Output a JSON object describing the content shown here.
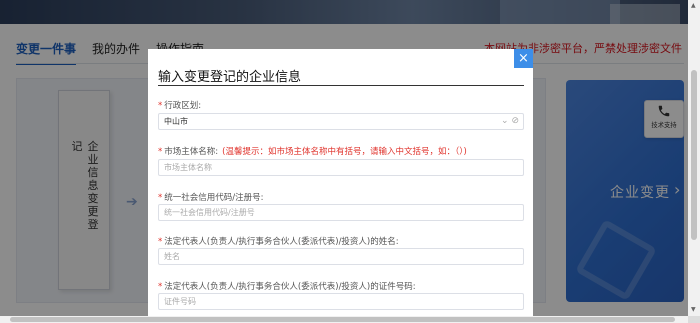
{
  "tabs": [
    {
      "label": "变更一件事"
    },
    {
      "label": "我的办件"
    },
    {
      "label": "操作指南"
    }
  ],
  "notice": "本网站为非涉密平台，严禁处理涉密文件",
  "flow_card": {
    "label": "企业信息变更登记"
  },
  "blue_card": {
    "title": "企业变更"
  },
  "float_button": {
    "label": "技术支持"
  },
  "modal": {
    "title": "输入变更登记的企业信息",
    "close": "×",
    "fields": [
      {
        "label": "行政区划:",
        "value": "中山市",
        "placeholder": ""
      },
      {
        "label": "市场主体名称:",
        "hint": "(温馨提示：如市场主体名称中有括号，请输入中文括号，如：（）)",
        "value": "",
        "placeholder": "市场主体名称"
      },
      {
        "label": "统一社会信用代码/注册号:",
        "value": "",
        "placeholder": "统一社会信用代码/注册号"
      },
      {
        "label": "法定代表人(负责人/执行事务合伙人(委派代表)/投资人)的姓名:",
        "value": "",
        "placeholder": "姓名"
      },
      {
        "label": "法定代表人(负责人/执行事务合伙人(委派代表)/投资人)的证件号码:",
        "value": "",
        "placeholder": "证件号码"
      }
    ]
  },
  "colors": {
    "primary": "#1d5fbf",
    "notice": "#d9141e",
    "close_button": "#3d8ee8"
  }
}
